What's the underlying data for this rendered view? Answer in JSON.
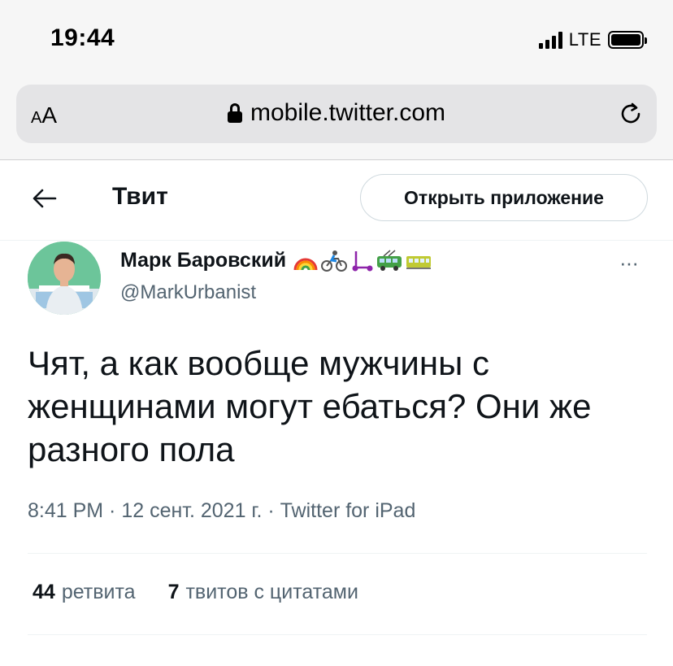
{
  "status_bar": {
    "time": "19:44",
    "network": "LTE"
  },
  "browser": {
    "text_size_label_small": "A",
    "text_size_label_big": "A",
    "url": "mobile.twitter.com",
    "icons": [
      "lock-icon",
      "reload-icon"
    ]
  },
  "header": {
    "back_icon": "arrow-left-icon",
    "title": "Твит",
    "open_app_label": "Открыть приложение"
  },
  "tweet": {
    "author_name": "Марк Баровский",
    "author_emojis": "🌈🚴🛴🚎🚃",
    "handle": "@MarkUrbanist",
    "more_label": "···",
    "text": "Чят, а как вообще мужчины с\nженщинами могут ебаться? Они же\nразного пола",
    "meta": "8:41 PM · 12 сент. 2021 г. · Twitter for iPad",
    "retweets_count": "44",
    "retweets_label": "ретвита",
    "quotes_count": "7",
    "quotes_label": "твитов с цитатами"
  },
  "colors": {
    "text_primary": "#0f1419",
    "text_secondary": "#536471",
    "border": "#cfd9de",
    "avatar_bg": "#6cc59a"
  }
}
